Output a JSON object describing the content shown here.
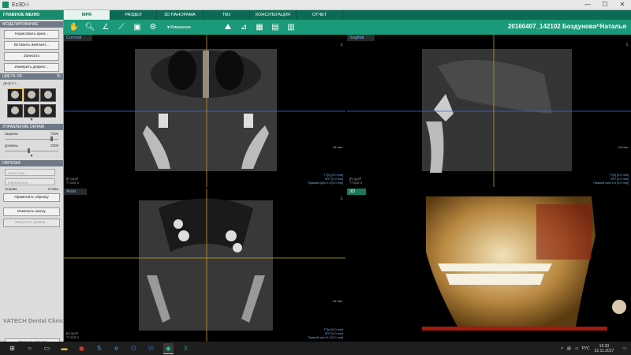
{
  "window": {
    "title": "Ez3D-i",
    "app_icon": "app-icon",
    "controls": [
      "minimize-icon",
      "maximize-icon",
      "close-icon"
    ]
  },
  "left_panel": {
    "main_menu_label": "ГЛАВНОЕ МЕНЮ",
    "modeling_header": "МОДЕЛИРОВАНИЕ",
    "modeling_buttons": [
      "Нарисовать ареа...",
      "Вставить имплант...",
      "Записать",
      "Измерить дефект..."
    ],
    "color_header": "ЦВЕТА VR",
    "color_preset_label": "Дефолт...",
    "window_header": "УПРАВЛЕНИЕ ОКНАМ",
    "width_label": "Ширина",
    "width_value": "7000",
    "level_label": "уровень",
    "level_value": "2000",
    "width_level_fraction": 0.88,
    "level_level_fraction": 0.45,
    "crop_header": "ОБРЕЗКА",
    "crop_dropdowns": [
      "Сагитталь...",
      "Коронально..."
    ],
    "crop_left": "Справа",
    "crop_right": "Слева",
    "apply_crop": "Применить обрезку",
    "edit_mask": "Изменить маску",
    "launch_plan": "Запустить режим...",
    "brand": "VATECH Dental Clinic",
    "open_project": "Открыть проект"
  },
  "tabs": [
    "MPR",
    "РАЗДЕЛ",
    "3D ПАНОРАМА",
    "TMJ",
    "КОНСУЛЬТАЦИЯ",
    "ОТЧЕТ"
  ],
  "active_tab": "MPR",
  "toolbar": {
    "icons": [
      "hand-icon",
      "zoom-icon",
      "angle-icon",
      "polyline-icon",
      "camera-icon",
      "settings-icon"
    ],
    "measure_label": "Измерение",
    "right_icons": [
      "mountain-icon",
      "ruler-icon",
      "layout1-icon",
      "layout2-icon",
      "layout3-icon"
    ],
    "patient": "20160407_142102  Боздунова^Наталья"
  },
  "viewports": {
    "coronal": {
      "label": "Coronal",
      "tick": "L",
      "scale": "10 mm",
      "info_left": "[F] Q12P\n77 0/22 3",
      "info_right": "TT[c] [9.0 mm]\nVRT [0.0 mm]\nПрямой срез 0.0 [0.0 mm]"
    },
    "sagittal": {
      "label": "Sagittal",
      "tick": "L",
      "scale": "10 mm",
      "info_left": "[F] Q12P\n77 0/22 3",
      "info_right": "TT[c] [9.0 mm]\nVRT [0.0 mm]\nПрямой срез 0.0 [0.0 mm]"
    },
    "axial": {
      "label": "Axial",
      "tick": "L",
      "scale": "10 mm",
      "info_left": "[F] Q12P\n77 0/22 3",
      "info_right": "TT[c] [9.0 mm]\nVRT [0.0 mm]\nПрямой срез 0.0 [0.0 mm]"
    },
    "3d": {
      "label": "3D"
    }
  },
  "taskbar": {
    "apps": [
      "windows-start-icon",
      "search-icon",
      "taskview-icon",
      "explorer-icon",
      "chrome-icon",
      "skype-icon",
      "ie-icon",
      "outlook-icon",
      "word-icon",
      "ez3d-icon",
      "excel-icon"
    ],
    "lang": "РУС",
    "time": "15:33",
    "date": "22.11.2017"
  },
  "colors": {
    "accent": "#178a6c",
    "tab_bar": "#0d6b55",
    "toolbar": "#1a9a7a",
    "crosshair_h": "#3a6aff",
    "crosshair_v": "#c89a2a"
  }
}
